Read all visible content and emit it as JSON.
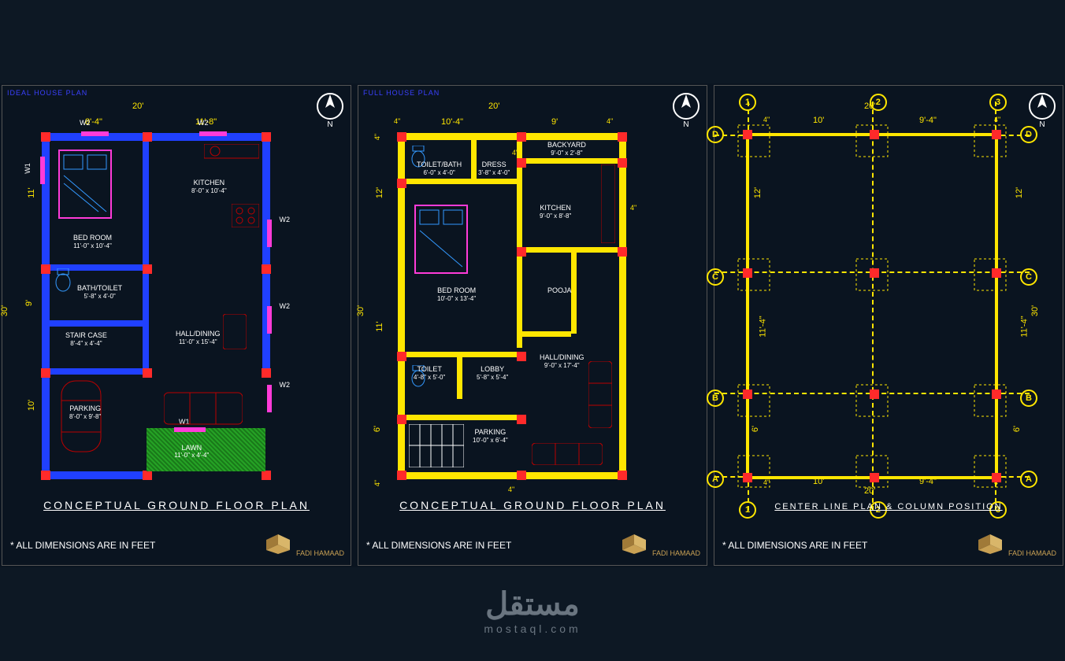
{
  "watermark": {
    "main": "مستقل",
    "sub": "mostaql.com"
  },
  "compass_label": "N",
  "footnote": "* ALL DIMENSIONS ARE IN FEET",
  "logo_text": "FADI HAMAAD",
  "panels": {
    "p1": {
      "subtype": "IDEAL HOUSE PLAN",
      "title": "CONCEPTUAL GROUND FLOOR PLAN",
      "overall_w": "20'",
      "overall_h": "30'",
      "top_dims": [
        "8'-4\"",
        "11'-8\""
      ],
      "left_dims": [
        "11'",
        "9'",
        "10'"
      ],
      "window_tag": "W2",
      "window_tag2": "W1",
      "rooms": {
        "bed": {
          "n": "BED ROOM",
          "d": "11'-0\" x 10'-4\""
        },
        "kitchen": {
          "n": "KITCHEN",
          "d": "8'-0\" x 10'-4\""
        },
        "bath": {
          "n": "BATH/TOILET",
          "d": "5'-8\" x 4'-0\""
        },
        "hall": {
          "n": "HALL/DINING",
          "d": "11'-0\" x 15'-4\""
        },
        "stair": {
          "n": "STAIR CASE",
          "d": "8'-4\" x 4'-4\""
        },
        "parking": {
          "n": "PARKING",
          "d": "8'-0\" x 9'-8\""
        },
        "lawn": {
          "n": "LAWN",
          "d": "11'-0\" x 4'-4\""
        }
      }
    },
    "p2": {
      "subtype": "FULL HOUSE PLAN",
      "title": "CONCEPTUAL GROUND FLOOR PLAN",
      "overall_w": "20'",
      "overall_h": "30'",
      "top_dims": [
        "10'-4\"",
        "9'"
      ],
      "wall_t": "4\"",
      "left_dims": [
        "12'",
        "11'",
        "6'"
      ],
      "rooms": {
        "back": {
          "n": "BACKYARD",
          "d": "9'-0\" x 2'-8\""
        },
        "tb": {
          "n": "TOILET/BATH",
          "d": "6'-0\" x 4'-0\""
        },
        "dress": {
          "n": "DRESS",
          "d": "3'-8\" x 4'-0\""
        },
        "kitchen": {
          "n": "KITCHEN",
          "d": "9'-0\" x 8'-8\""
        },
        "bed": {
          "n": "BED ROOM",
          "d": "10'-0\" x 13'-4\""
        },
        "pooja": {
          "n": "POOJA",
          "d": ""
        },
        "toilet": {
          "n": "TOILET",
          "d": "4'-8\" x 5'-0\""
        },
        "lobby": {
          "n": "LOBBY",
          "d": "5'-8\" x 5'-4\""
        },
        "hall": {
          "n": "HALL/DINING",
          "d": "9'-0\" x 17'-4\""
        },
        "parking": {
          "n": "PARKING",
          "d": "10'-0\" x 6'-4\""
        }
      }
    },
    "p3": {
      "title": "CENTER LINE PLAN & COLUMN POSITION",
      "overall_w": "20'",
      "overall_h": "30'",
      "top_dims": [
        "10'",
        "9'-4\""
      ],
      "bot_dims": [
        "10'",
        "9'-4\""
      ],
      "left_dims": [
        "12'",
        "11'-4\"",
        "6'"
      ],
      "right_dims": [
        "12'",
        "11'-4\"",
        "6'"
      ],
      "wall_t": "4\"",
      "cols": [
        "1",
        "2",
        "3"
      ],
      "rows": [
        "A",
        "B",
        "C",
        "D"
      ]
    }
  }
}
